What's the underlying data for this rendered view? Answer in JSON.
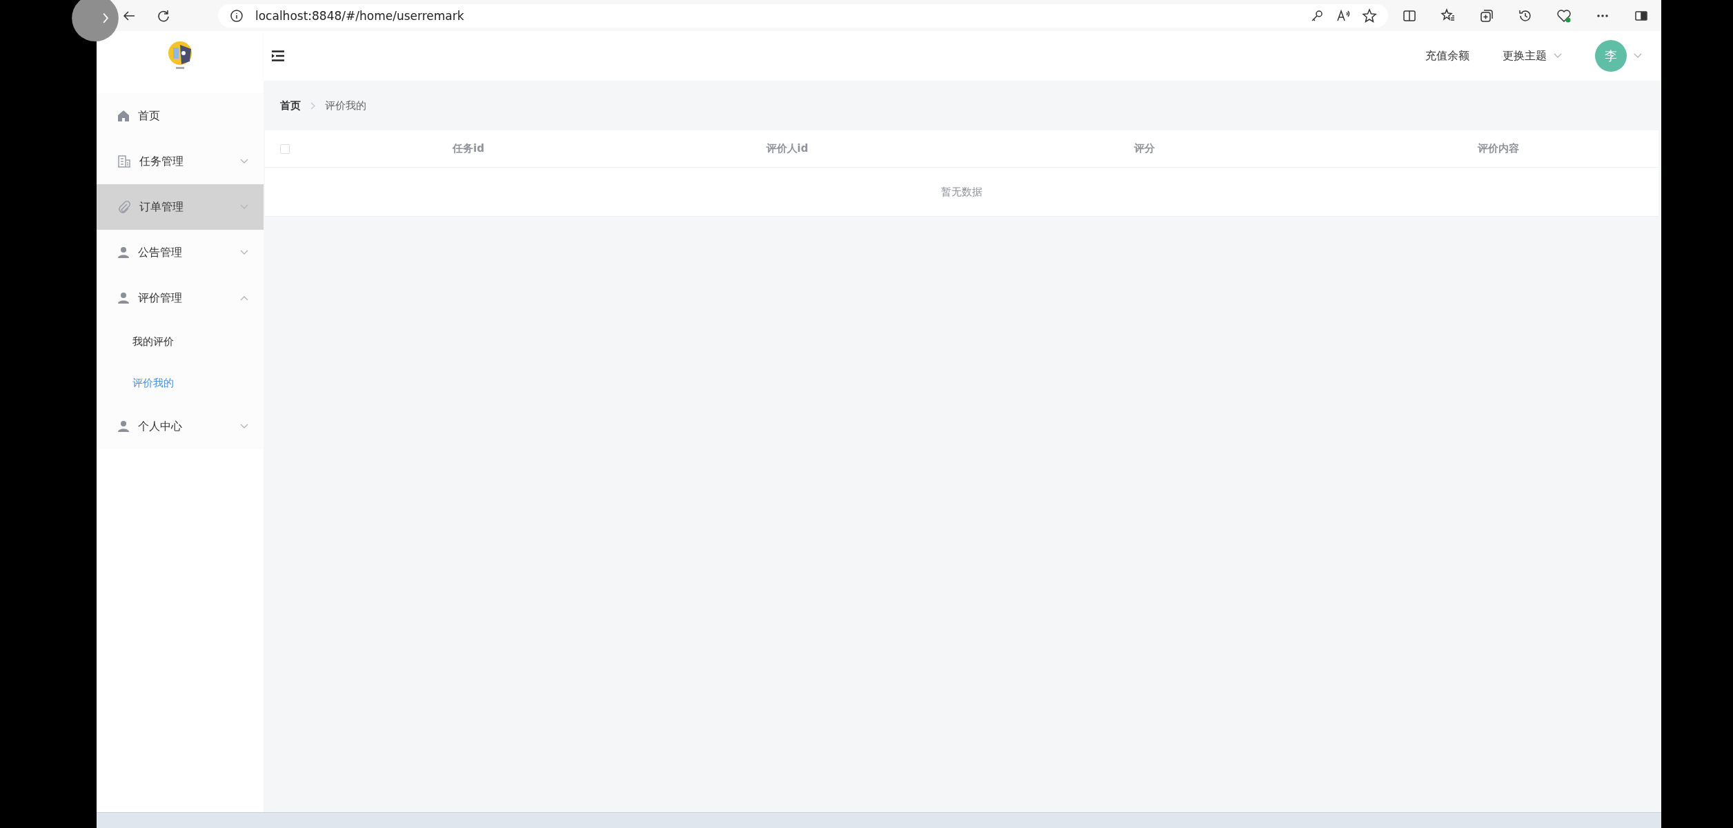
{
  "browser": {
    "url": "localhost:8848/#/home/userremark"
  },
  "header": {
    "links": [
      "充值余额",
      "更换主题"
    ],
    "avatar": "李"
  },
  "sidebar": {
    "items": [
      {
        "label": "首页",
        "kind": "home",
        "hovered": false
      },
      {
        "label": "任务管理",
        "kind": "building",
        "hovered": false,
        "expanded": false
      },
      {
        "label": "订单管理",
        "kind": "clip",
        "hovered": true,
        "expanded": false
      },
      {
        "label": "公告管理",
        "kind": "user",
        "hovered": false,
        "expanded": false
      },
      {
        "label": "评价管理",
        "kind": "user",
        "hovered": false,
        "expanded": true,
        "children": [
          {
            "label": "我的评价",
            "selected": false
          },
          {
            "label": "评价我的",
            "selected": true
          }
        ]
      },
      {
        "label": "个人中心",
        "kind": "user",
        "hovered": false,
        "expanded": false
      }
    ]
  },
  "breadcrumb": [
    "首页",
    "评价我的"
  ],
  "table": {
    "select_all_checked": false,
    "columns": [
      "任务id",
      "评价人id",
      "评分",
      "评价内容"
    ],
    "empty_text": "暂无数据"
  }
}
